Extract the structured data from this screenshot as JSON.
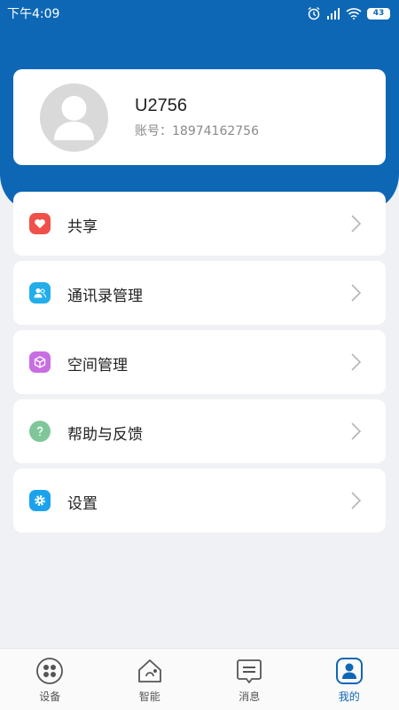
{
  "status_bar": {
    "time": "下午4:09",
    "battery": "43"
  },
  "profile": {
    "username": "U2756",
    "account_label": "账号：",
    "account_number": "18974162756"
  },
  "menu": [
    {
      "label": "共享",
      "icon": "heart-icon",
      "color": "#f0504a"
    },
    {
      "label": "通讯录管理",
      "icon": "contacts-icon",
      "color": "#22aeea"
    },
    {
      "label": "空间管理",
      "icon": "cube-icon",
      "color": "#c86ee0"
    },
    {
      "label": "帮助与反馈",
      "icon": "question-icon",
      "color": "#7fc79a"
    },
    {
      "label": "设置",
      "icon": "gear-icon",
      "color": "#1aa3ec"
    }
  ],
  "tabs": [
    {
      "label": "设备",
      "icon": "devices-icon",
      "active": false
    },
    {
      "label": "智能",
      "icon": "smart-home-icon",
      "active": false
    },
    {
      "label": "消息",
      "icon": "message-icon",
      "active": false
    },
    {
      "label": "我的",
      "icon": "profile-icon",
      "active": true
    }
  ],
  "colors": {
    "primary": "#0d67b5",
    "background": "#f0f1f5",
    "avatar": "#d9d9d9"
  }
}
